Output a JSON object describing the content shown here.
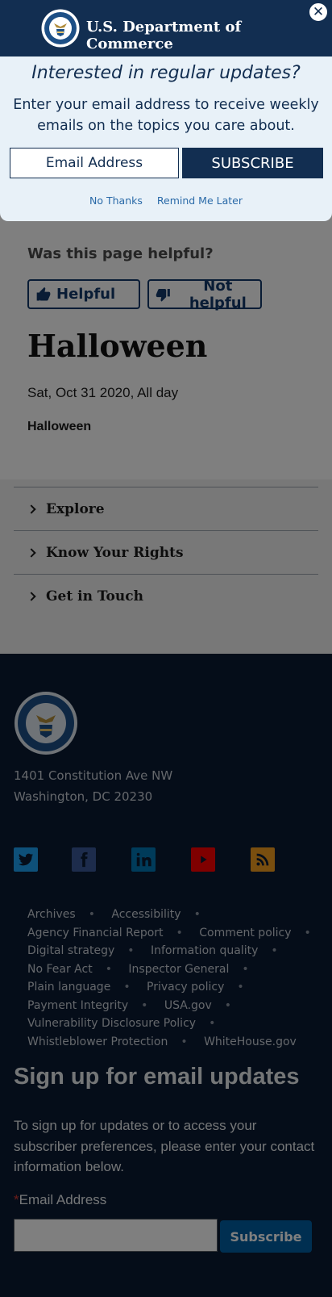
{
  "modal": {
    "department": "U.S. Department of Commerce",
    "close_symbol": "✕",
    "question": "Interested in regular updates?",
    "description": "Enter your email address to receive weekly emails on the topics you care about.",
    "email_placeholder": "Email Address",
    "subscribe_label": "SUBSCRIBE",
    "no_thanks": "No Thanks",
    "remind_later": "Remind Me Later"
  },
  "feedback": {
    "question": "Was this page helpful?",
    "helpful_label": "Helpful",
    "not_helpful_label": "Not helpful"
  },
  "event": {
    "title": "Halloween",
    "date": "Sat, Oct 31 2020, All day",
    "name": "Halloween"
  },
  "accordion": [
    {
      "label": "Explore"
    },
    {
      "label": "Know Your Rights"
    },
    {
      "label": "Get in Touch"
    }
  ],
  "footer": {
    "address_line1": "1401 Constitution Ave NW",
    "address_line2": "Washington, DC 20230",
    "social": [
      {
        "icon": "twitter-icon",
        "color": "#1da1f2"
      },
      {
        "icon": "facebook-icon",
        "color": "#3b5998"
      },
      {
        "icon": "linkedin-icon",
        "color": "#0077b5"
      },
      {
        "icon": "youtube-icon",
        "color": "#ff0000"
      },
      {
        "icon": "rss-icon",
        "color": "#f29c1f"
      }
    ],
    "links": [
      "Archives",
      "Accessibility",
      "Agency Financial Report",
      "Comment policy",
      "Digital strategy",
      "Information quality",
      "No Fear Act",
      "Inspector General",
      "Plain language",
      "Privacy policy",
      "Payment Integrity",
      "USA.gov",
      "Vulnerability Disclosure Policy",
      "Whistleblower Protection",
      "WhiteHouse.gov"
    ],
    "signup_heading": "Sign up for email updates",
    "signup_text": "To sign up for updates or to access your subscriber preferences, please enter your contact information below.",
    "required_marker": "*",
    "email_label": "Email Address",
    "subscribe_label": "Subscribe"
  }
}
